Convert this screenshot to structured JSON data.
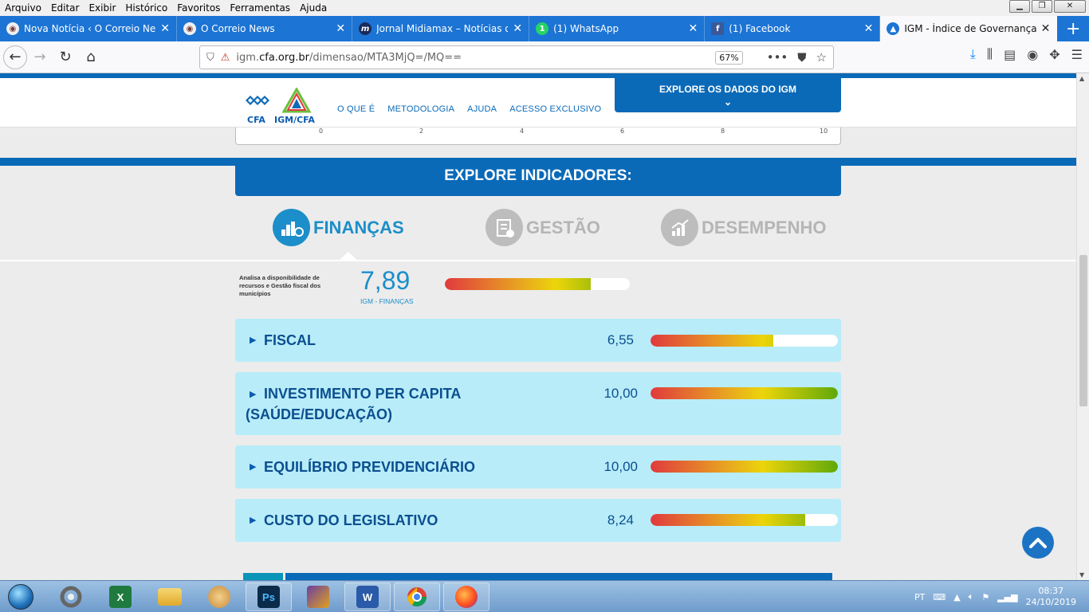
{
  "menubar": {
    "items": [
      "Arquivo",
      "Editar",
      "Exibir",
      "Histórico",
      "Favoritos",
      "Ferramentas",
      "Ajuda"
    ]
  },
  "tabs": [
    {
      "title": "Nova Notícia ‹ O Correio News",
      "icon": "correio-favicon",
      "color": "#7a3c3c"
    },
    {
      "title": "O Correio News",
      "icon": "correio-favicon",
      "color": "#7a3c3c"
    },
    {
      "title": "Jornal Midiamax – Notícias de Ca",
      "icon": "midiamax-favicon",
      "color": "#1a2a5a"
    },
    {
      "title": "(1) WhatsApp",
      "icon": "whatsapp-favicon",
      "color": "#25d366"
    },
    {
      "title": "(1) Facebook",
      "icon": "facebook-favicon",
      "color": "#3b5998"
    },
    {
      "title": "IGM - Índice de Governança Mu",
      "icon": "igm-favicon",
      "color": "#1c74d4"
    }
  ],
  "navbar": {
    "url_prefix": "igm.",
    "url_host": "cfa.org.br",
    "url_path": "/dimensao/MTA3MjQ=/MQ==",
    "zoom": "67%"
  },
  "site": {
    "logo_cfa": "CFA",
    "logo_igm": "IGM/CFA",
    "nav": [
      "O QUE É",
      "METODOLOGIA",
      "AJUDA",
      "ACESSO EXCLUSIVO"
    ],
    "explore_button": "EXPLORE OS DADOS DO IGM",
    "axis_ticks": [
      "0",
      "2",
      "4",
      "6",
      "8",
      "10"
    ],
    "explore_title": "EXPLORE INDICADORES:",
    "categories": [
      {
        "label": "FINANÇAS",
        "active": true
      },
      {
        "label": "GESTÃO",
        "active": false
      },
      {
        "label": "DESEMPENHO",
        "active": false
      }
    ],
    "summary": {
      "description": "Analisa a disponibilidade de recursos e Gestão fiscal dos municípios",
      "score": "7,89",
      "score_value": 7.89,
      "score_label": "IGM - FINANÇAS"
    },
    "indicators": [
      {
        "line1": "FISCAL",
        "line2": "",
        "value": "6,55",
        "value_num": 6.55
      },
      {
        "line1": "INVESTIMENTO PER CAPITA",
        "line2": "(SAÚDE/EDUCAÇÃO)",
        "value": "10,00",
        "value_num": 10.0
      },
      {
        "line1": "EQUILÍBRIO PREVIDENCIÁRIO",
        "line2": "",
        "value": "10,00",
        "value_num": 10.0
      },
      {
        "line1": "CUSTO DO LEGISLATIVO",
        "line2": "",
        "value": "8,24",
        "value_num": 8.24
      }
    ],
    "max_value": 10
  },
  "taskbar": {
    "apps": [
      {
        "icon": "chrome-old-icon",
        "label": ""
      },
      {
        "icon": "excel-icon",
        "label": "X"
      },
      {
        "icon": "explorer-folder-icon",
        "label": ""
      },
      {
        "icon": "paint-icon",
        "label": ""
      },
      {
        "icon": "photoshop-icon",
        "label": "Ps"
      },
      {
        "icon": "video-editor-icon",
        "label": ""
      },
      {
        "icon": "word-icon",
        "label": "W"
      },
      {
        "icon": "chrome-icon",
        "label": ""
      },
      {
        "icon": "firefox-icon",
        "label": ""
      }
    ],
    "lang": "PT",
    "time": "08:37",
    "date": "24/10/2019"
  }
}
